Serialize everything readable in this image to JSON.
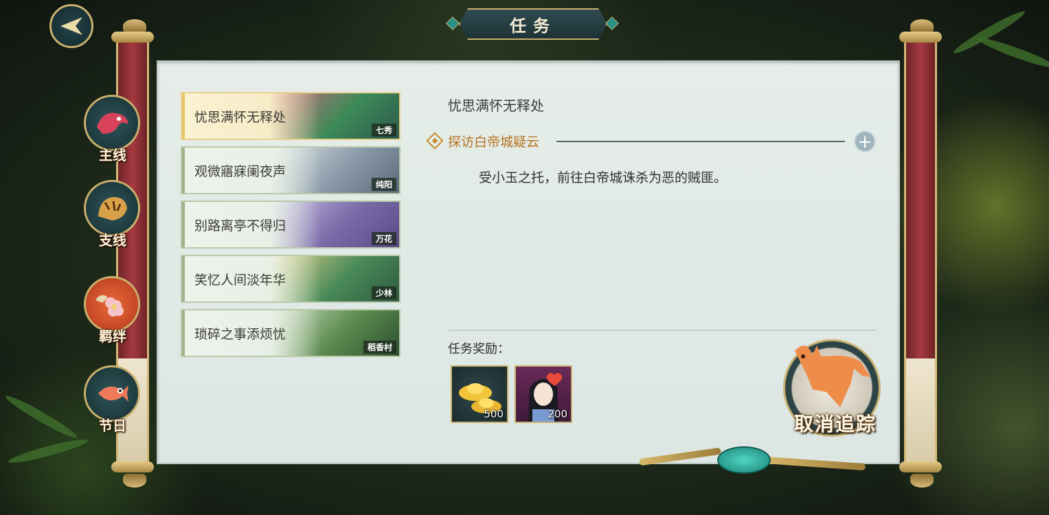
{
  "header": {
    "title": "任务"
  },
  "categories": [
    {
      "label": "主线",
      "icon": "dragon-icon"
    },
    {
      "label": "支线",
      "icon": "tiger-icon"
    },
    {
      "label": "羁绊",
      "icon": "flower-bird-icon",
      "active": true
    },
    {
      "label": "节日",
      "icon": "fish-icon"
    }
  ],
  "quests": [
    {
      "name": "忧思满怀无释处",
      "tag": "七秀",
      "active": true
    },
    {
      "name": "观微寤寐阑夜声",
      "tag": "纯阳"
    },
    {
      "name": "别路离亭不得归",
      "tag": "万花"
    },
    {
      "name": "笑忆人间淡年华",
      "tag": "少林"
    },
    {
      "name": "琐碎之事添烦忧",
      "tag": "稻香村"
    }
  ],
  "detail": {
    "title": "忧思满怀无释处",
    "objective": "探访白帝城疑云",
    "description": "受小玉之托，前往白帝城诛杀为恶的贼匪。",
    "reward_label": "任务奖励：",
    "rewards": [
      {
        "type": "gold-ingot-icon",
        "count": "500"
      },
      {
        "type": "character-portrait-icon",
        "count": "200"
      }
    ]
  },
  "actions": {
    "cancel_tracking": "取消追踪"
  },
  "colors": {
    "accent": "#c9b06e",
    "objective": "#b5731e",
    "scroll_red": "#a53a40",
    "panel": "#e3ebe7"
  }
}
